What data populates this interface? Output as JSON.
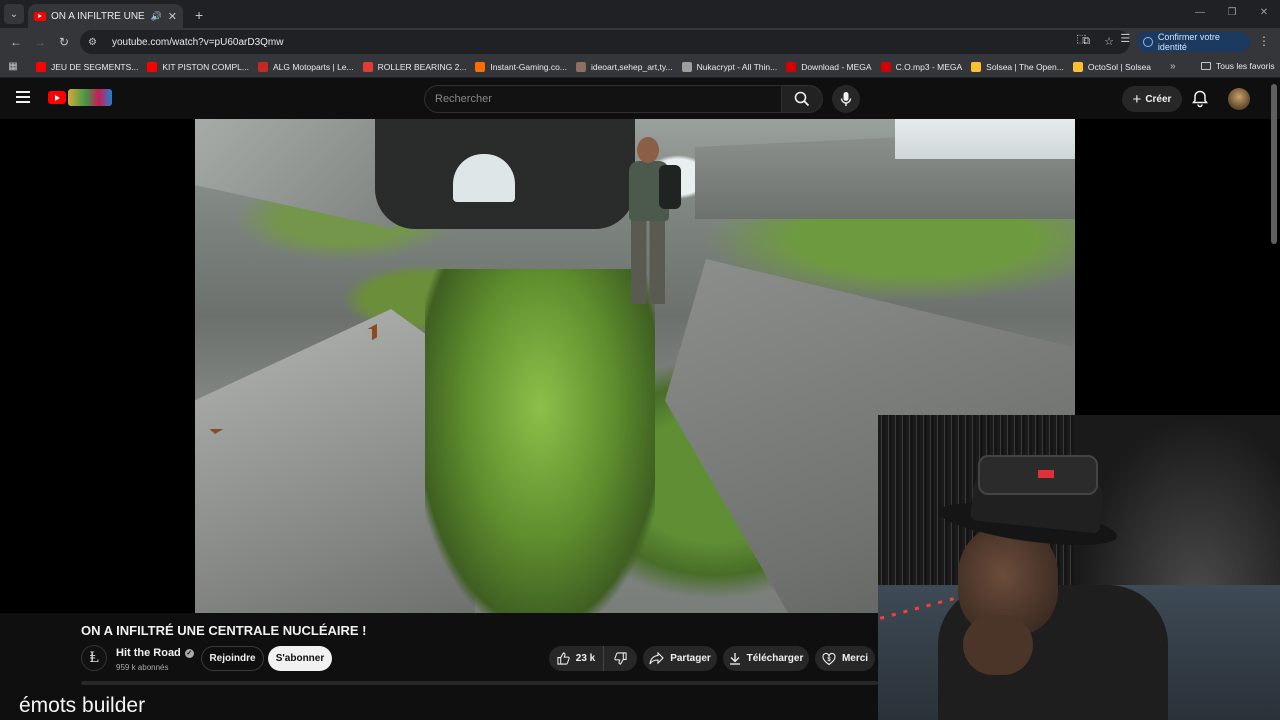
{
  "browser": {
    "tab_title": "ON A INFILTRÉ UNE CENTR",
    "url": "youtube.com/watch?v=pU60arD3Qmw",
    "confirm_identity": "Confirmer votre identité",
    "bookmarks": [
      {
        "label": "JEU DE SEGMENTS...",
        "color": "#ff0000"
      },
      {
        "label": "KIT PISTON COMPL...",
        "color": "#ff0000"
      },
      {
        "label": "ALG Motoparts | Le...",
        "color": "#c62828"
      },
      {
        "label": "ROLLER BEARING 2...",
        "color": "#e53935"
      },
      {
        "label": "Instant-Gaming.co...",
        "color": "#ff6d00"
      },
      {
        "label": "ideoart,sehep_art,ty...",
        "color": "#8d6e63"
      },
      {
        "label": "Nukacrypt - All Thin...",
        "color": "#9e9e9e"
      },
      {
        "label": "Download - MEGA",
        "color": "#d50000"
      },
      {
        "label": "C.O.mp3 - MEGA",
        "color": "#d50000"
      },
      {
        "label": "Solsea | The Open...",
        "color": "#fbc02d"
      },
      {
        "label": "OctoSol | Solsea",
        "color": "#fbc02d"
      }
    ],
    "all_favorites": "Tous les favoris"
  },
  "youtube": {
    "search_placeholder": "Rechercher",
    "create_label": "Créer",
    "video_title": "ON A INFILTRÉ UNE CENTRALE NUCLÉAIRE !",
    "channel_name": "Hit the Road",
    "channel_initial": "Ⱡ",
    "subscribers": "959 k abonnés",
    "join_label": "Rejoindre",
    "subscribe_label": "S'abonner",
    "likes": "23 k",
    "share_label": "Partager",
    "download_label": "Télécharger",
    "thanks_label": "Merci"
  },
  "overlay": {
    "text": "émots builder"
  }
}
